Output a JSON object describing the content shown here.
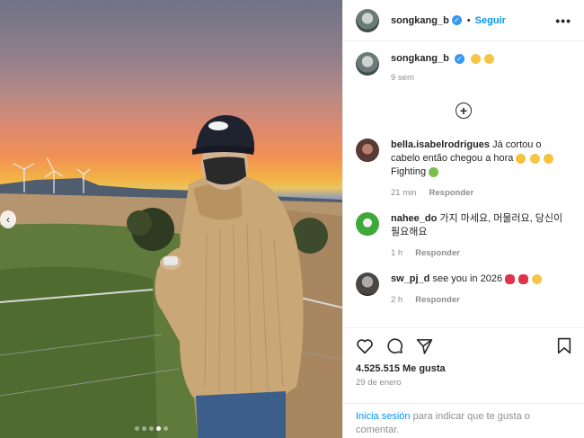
{
  "post": {
    "author": "songkang_b",
    "follow_label": "Seguir",
    "caption_time": "9 sem",
    "likes": "4.525.515 Me gusta",
    "date": "29 de enero",
    "login_link": "Inicia sesión",
    "login_suffix": " para indicar que te gusta o comentar.",
    "carousel_total": 5,
    "carousel_active": 4
  },
  "comments": [
    {
      "user": "bella.isabelrodrigues",
      "text": "Já cortou o cabelo então chegou a hora",
      "tail": "Fighting",
      "time": "21 min",
      "reply": "Responder"
    },
    {
      "user": "nahee_do",
      "text": "가지 마세요, 머물러요, 당신이 필요해요",
      "time": "1 h",
      "reply": "Responder"
    },
    {
      "user": "sw_pj_d",
      "text": "see you in 2026",
      "time": "2 h",
      "reply": "Responder"
    }
  ],
  "colors": {
    "accent": "#0095f6",
    "verified": "#3897f0"
  },
  "icons": [
    "verified-icon",
    "more-icon",
    "plus-circle-icon",
    "heart-icon",
    "comment-icon",
    "share-icon",
    "save-icon",
    "chevron-left-icon"
  ]
}
